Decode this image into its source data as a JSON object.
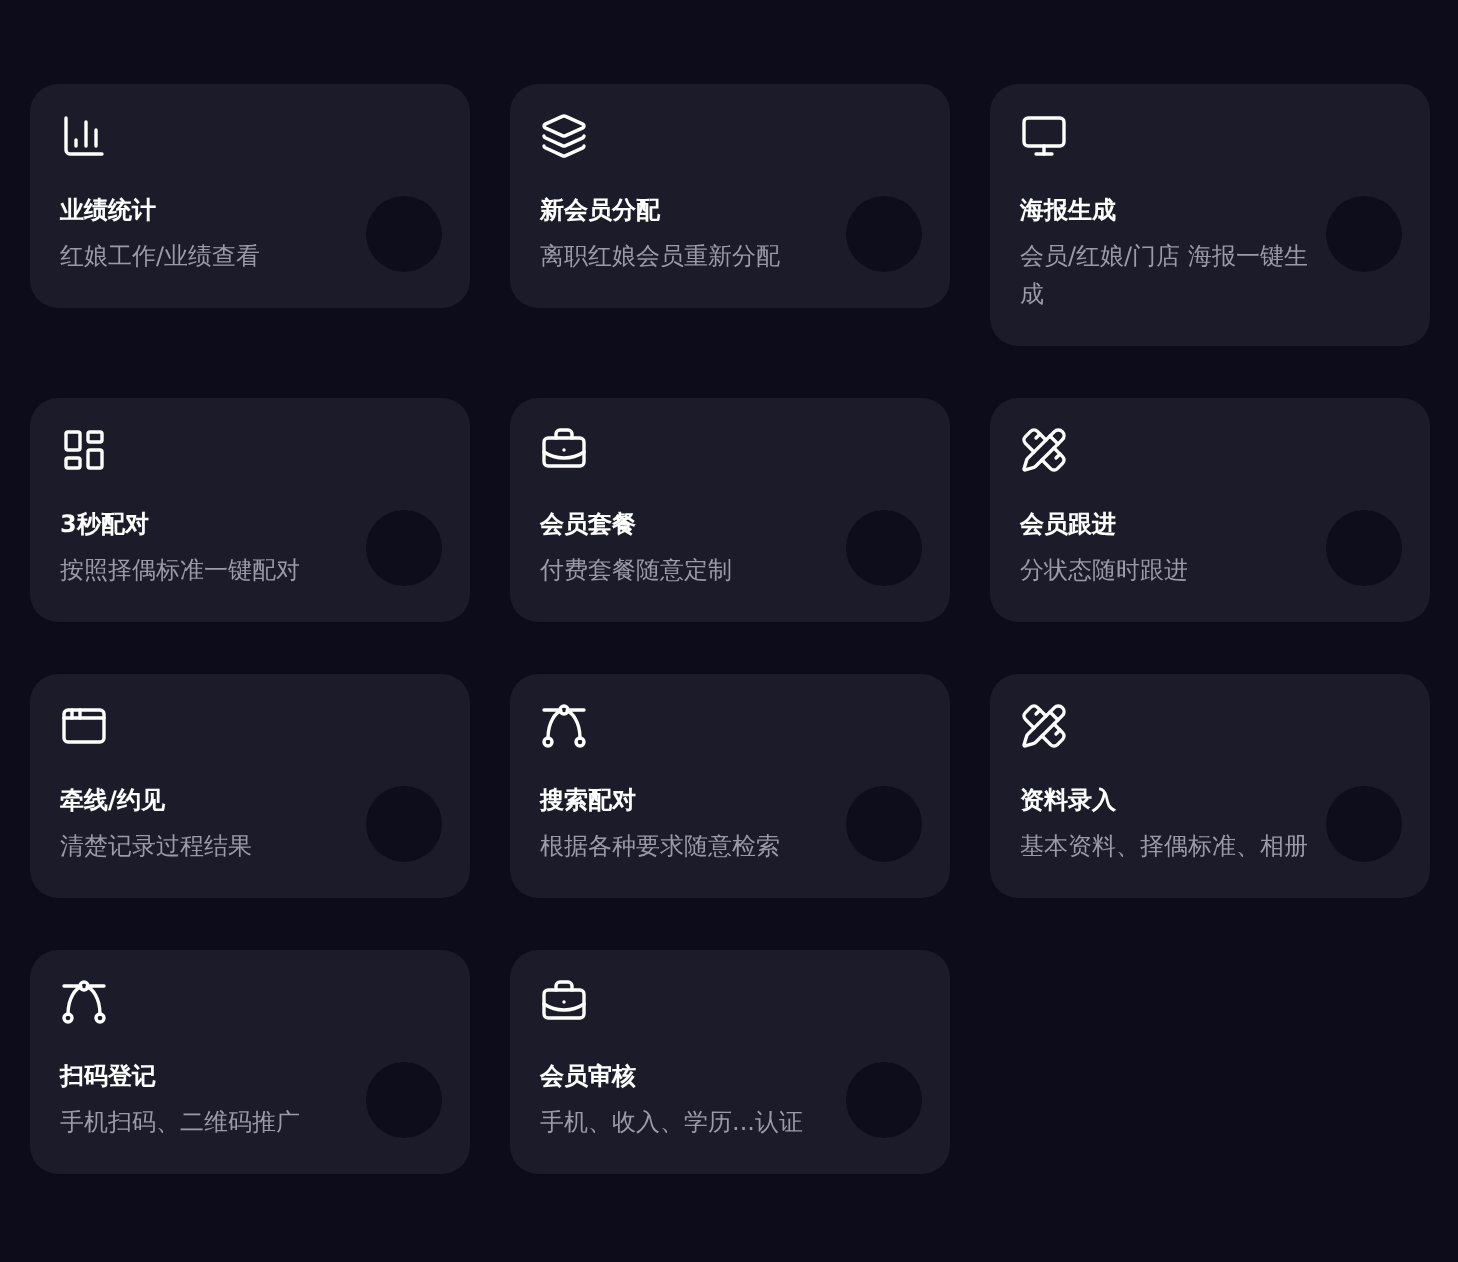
{
  "cards": [
    {
      "title": "业绩统计",
      "description": "红娘工作/业绩查看"
    },
    {
      "title": "新会员分配",
      "description": "离职红娘会员重新分配"
    },
    {
      "title": "海报生成",
      "description": "会员/红娘/门店 海报一键生成"
    },
    {
      "title": "3秒配对",
      "description": "按照择偶标准一键配对"
    },
    {
      "title": "会员套餐",
      "description": "付费套餐随意定制"
    },
    {
      "title": "会员跟进",
      "description": "分状态随时跟进"
    },
    {
      "title": "牵线/约见",
      "description": "清楚记录过程结果"
    },
    {
      "title": "搜索配对",
      "description": "根据各种要求随意检索"
    },
    {
      "title": "资料录入",
      "description": "基本资料、择偶标准、相册"
    },
    {
      "title": "扫码登记",
      "description": "手机扫码、二维码推广"
    },
    {
      "title": "会员审核",
      "description": "手机、收入、学历...认证"
    }
  ]
}
